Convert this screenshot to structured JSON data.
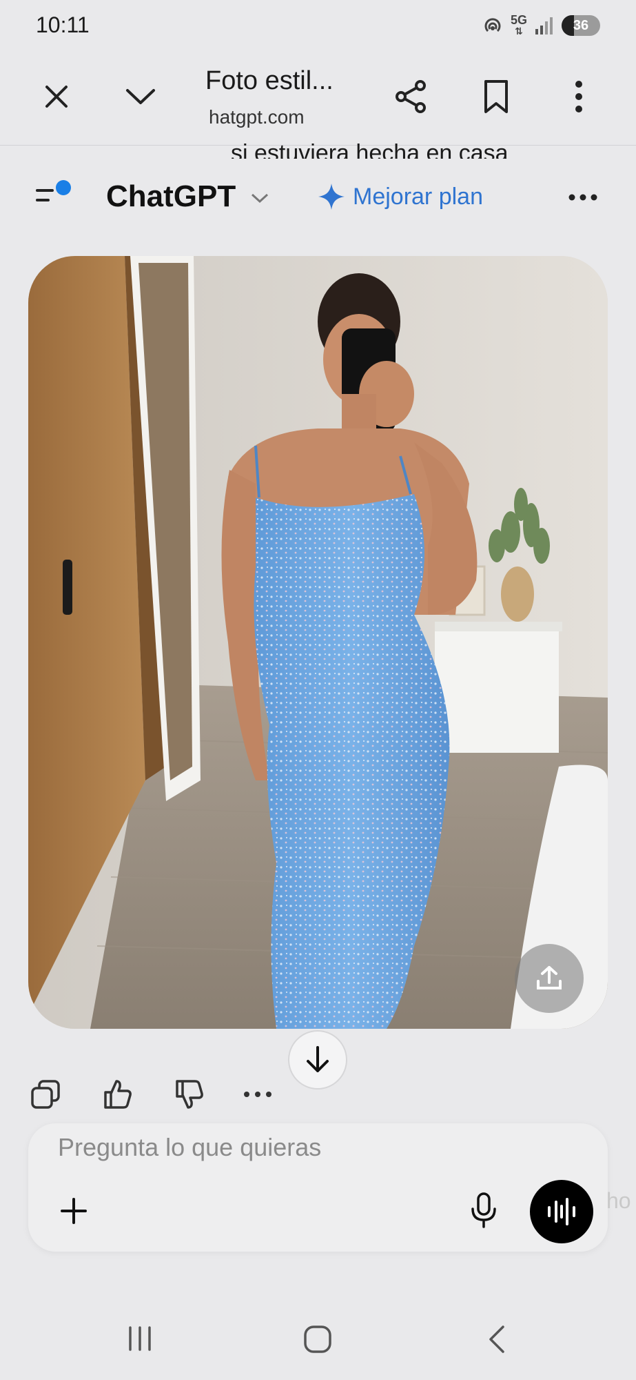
{
  "status_bar": {
    "time": "10:11",
    "network_label": "5G",
    "battery": "36"
  },
  "toolbar": {
    "title": "Foto estil...",
    "domain": "hatgpt.com"
  },
  "peek_text": "si estuviera hecha en casa",
  "chat_header": {
    "app_title": "ChatGPT",
    "upgrade_label": "Mejorar plan",
    "accent_color": "#2f74d0"
  },
  "composer": {
    "placeholder": "Pregunta lo que quieras"
  },
  "edge_text": "ho",
  "colors": {
    "background": "#e9e9eb",
    "voice_button": "#000000",
    "notification_dot": "#1a7fe6"
  }
}
